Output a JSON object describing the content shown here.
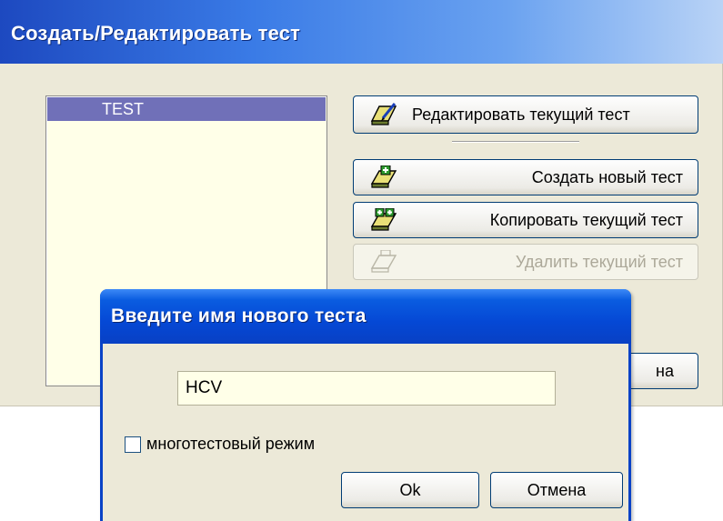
{
  "main_window": {
    "title": "Создать/Редактировать тест",
    "test_list": {
      "items": [
        "TEST"
      ],
      "selected": "TEST"
    },
    "buttons": {
      "edit": "Редактировать текущий тест",
      "create": "Создать новый тест",
      "copy": "Копировать текущий тест",
      "delete": "Удалить текущий тест",
      "close_partial": "на"
    }
  },
  "dialog": {
    "title": "Введите имя нового теста",
    "name_input_value": "HCV",
    "checkbox_label": "многотестовый режим",
    "checkbox_checked": false,
    "ok": "Ok",
    "cancel": "Отмена"
  },
  "colors": {
    "title_gradient_start": "#1d49c0",
    "dialog_title": "#0548d5",
    "list_selection": "#7070b8",
    "list_background": "#ffffe8",
    "window_face": "#ece9d8"
  },
  "icons": {
    "edit": "edit-document-icon",
    "create": "new-document-icon",
    "copy": "copy-document-icon",
    "delete": "delete-document-icon"
  }
}
